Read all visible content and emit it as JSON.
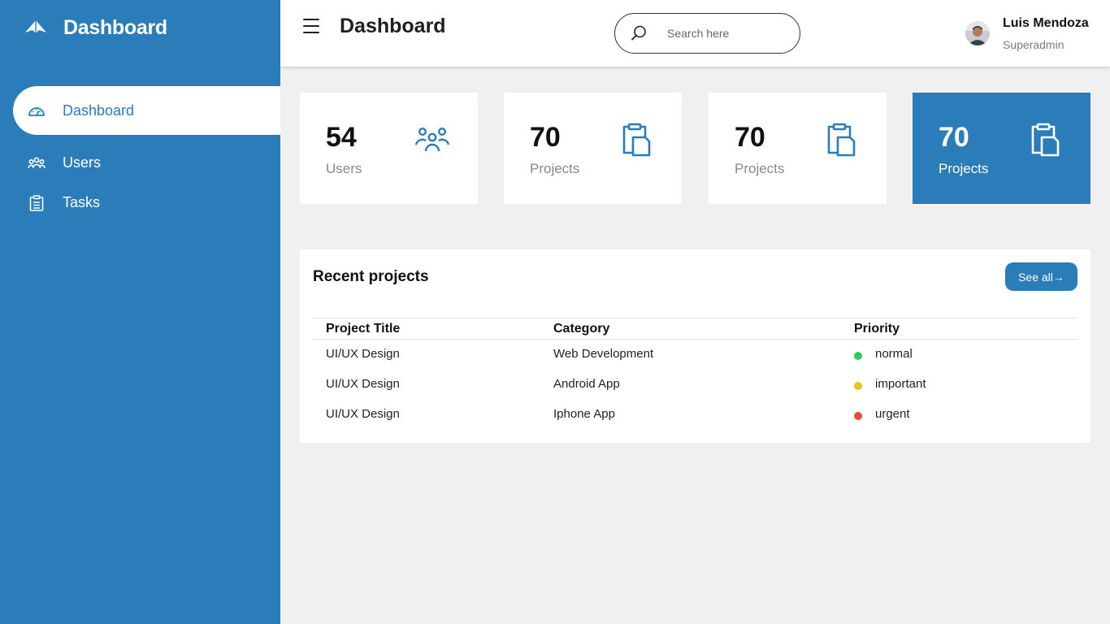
{
  "sidebar": {
    "brand": {
      "title": "Dashboard",
      "icon": "paper-plane-logo-icon"
    },
    "items": [
      {
        "label": "Dashboard",
        "icon": "gauge-icon",
        "active": true
      },
      {
        "label": "Users",
        "icon": "users-icon",
        "active": false
      },
      {
        "label": "Tasks",
        "icon": "clipboard-list-icon",
        "active": false
      }
    ]
  },
  "topbar": {
    "title": "Dashboard",
    "search": {
      "placeholder": "Search here",
      "value": ""
    },
    "user": {
      "name": "Luis Mendoza",
      "role": "Superadmin"
    }
  },
  "cards": [
    {
      "value": "54",
      "label": "Users",
      "icon": "users-group-icon",
      "highlight": false
    },
    {
      "value": "70",
      "label": "Projects",
      "icon": "clipboard-copy-icon",
      "highlight": false
    },
    {
      "value": "70",
      "label": "Projects",
      "icon": "clipboard-copy-icon",
      "highlight": false
    },
    {
      "value": "70",
      "label": "Projects",
      "icon": "clipboard-copy-icon",
      "highlight": true
    }
  ],
  "recent": {
    "title": "Recent projects",
    "see_all_label": "See all→",
    "columns": [
      "Project Title",
      "Category",
      "Priority"
    ],
    "rows": [
      {
        "title": "UI/UX Design",
        "category": "Web Development",
        "priority": "normal",
        "color": "#2ecc55"
      },
      {
        "title": "UI/UX Design",
        "category": "Android App",
        "priority": "important",
        "color": "#f0c020"
      },
      {
        "title": "UI/UX Design",
        "category": "Iphone App",
        "priority": "urgent",
        "color": "#e74c3c"
      }
    ]
  },
  "colors": {
    "primary": "#2a7db8",
    "background": "#f0f0f0"
  }
}
